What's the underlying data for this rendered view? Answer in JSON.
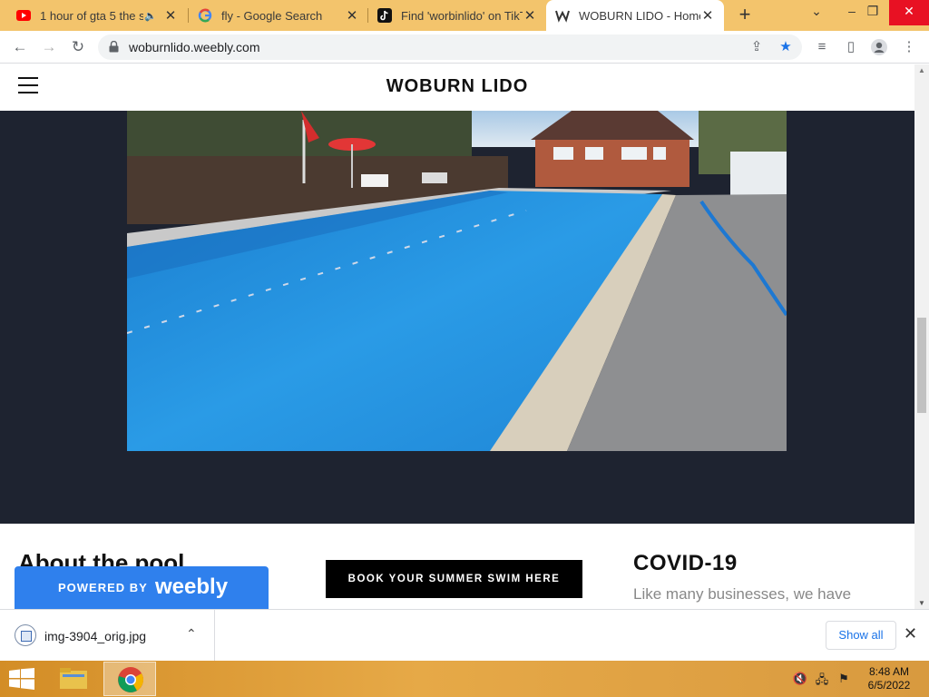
{
  "browser": {
    "tabs": [
      {
        "title": "1 hour of gta 5 the s",
        "favicon": "youtube-icon",
        "audio": true,
        "active": false
      },
      {
        "title": "fly - Google Search",
        "favicon": "google-icon",
        "audio": false,
        "active": false
      },
      {
        "title": "Find 'worbinlido' on TikT",
        "favicon": "tiktok-icon",
        "audio": false,
        "active": false
      },
      {
        "title": "WOBURN LIDO - Home",
        "favicon": "weebly-icon",
        "audio": false,
        "active": true
      }
    ],
    "url": "woburnlido.weebly.com"
  },
  "site": {
    "title": "WOBURN LIDO",
    "about_title": "About the pool",
    "book_button": "BOOK YOUR SUMMER SWIM HERE",
    "covid_title": "COVID-19",
    "covid_text": "Like many businesses, we have",
    "badge": {
      "powered_by": "POWERED BY",
      "brand": "weebly"
    }
  },
  "downloads": {
    "file_name": "img-3904_orig.jpg",
    "show_all": "Show all"
  },
  "taskbar": {
    "time": "8:48 AM",
    "date": "6/5/2022"
  },
  "colors": {
    "tab_strip": "#f3c46c",
    "hero_bg": "#1e2330",
    "weebly_blue": "#2f80ed",
    "link_blue": "#1a73e8"
  }
}
